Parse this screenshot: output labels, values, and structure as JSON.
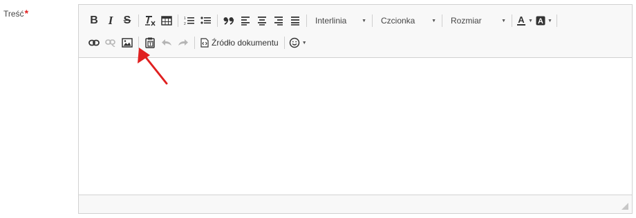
{
  "field": {
    "label": "Treść",
    "required_mark": "*"
  },
  "toolbar": {
    "bold_label": "B",
    "italic_label": "I",
    "strike_label": "S",
    "quote_label": "❞",
    "line_height_label": "Interlinia",
    "font_label": "Czcionka",
    "size_label": "Rozmiar",
    "source_label": "Źródło dokumentu",
    "combo_arrow": "▼"
  },
  "icons": [
    "bold-icon",
    "italic-icon",
    "strikethrough-icon",
    "remove-format-icon",
    "table-icon",
    "numbered-list-icon",
    "bulleted-list-icon",
    "blockquote-icon",
    "align-left-icon",
    "align-center-icon",
    "align-right-icon",
    "justify-icon",
    "text-color-icon",
    "background-color-icon",
    "link-icon",
    "unlink-icon",
    "image-icon",
    "paste-text-icon",
    "undo-icon",
    "redo-icon",
    "source-icon",
    "emoji-icon",
    "resize-handle-icon"
  ],
  "colors": {
    "accent_red": "#e02020",
    "toolbar_bg": "#f8f8f8",
    "border": "#d1d1d1"
  }
}
